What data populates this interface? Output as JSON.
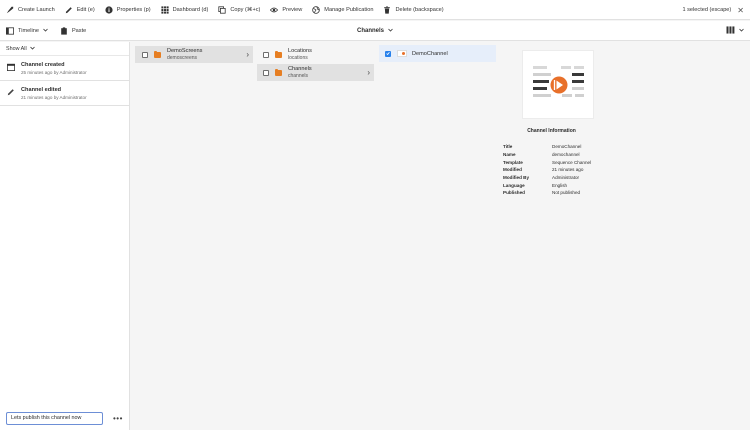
{
  "toolbar": {
    "items": [
      {
        "label": "Create Launch",
        "icon": "rocket-icon"
      },
      {
        "label": "Edit (e)",
        "icon": "pencil-icon"
      },
      {
        "label": "Properties (p)",
        "icon": "info-icon"
      },
      {
        "label": "Dashboard (d)",
        "icon": "grid-icon"
      },
      {
        "label": "Copy (⌘+c)",
        "icon": "copy-icon"
      },
      {
        "label": "Preview",
        "icon": "eye-icon"
      },
      {
        "label": "Manage Publication",
        "icon": "globe-icon"
      },
      {
        "label": "Delete (backspace)",
        "icon": "trash-icon"
      }
    ],
    "selection_label": "1 selected (escape)"
  },
  "subbar": {
    "timeline_label": "Timeline",
    "paste_label": "Paste",
    "title": "Channels"
  },
  "rail": {
    "filter_label": "Show All",
    "events": [
      {
        "title": "Channel created",
        "subtitle": "25 minutes ago by Administrator",
        "icon": "calendar-icon"
      },
      {
        "title": "Channel edited",
        "subtitle": "21 minutes ago by Administrator",
        "icon": "pencil-icon"
      }
    ],
    "comment_value": "Lets publish this channel now",
    "more_label": "•••"
  },
  "columns": {
    "col1": [
      {
        "title": "DemoScreens",
        "subtitle": "demoscreens"
      }
    ],
    "col2": [
      {
        "title": "Locations",
        "subtitle": "locations"
      },
      {
        "title": "Channels",
        "subtitle": "channels"
      }
    ],
    "col3": [
      {
        "title": "DemoChannel"
      }
    ]
  },
  "info": {
    "heading": "Channel Information",
    "rows": [
      {
        "key": "Title",
        "value": "DemoChannel"
      },
      {
        "key": "Name",
        "value": "demochannel"
      },
      {
        "key": "Template",
        "value": "Sequence Channel"
      },
      {
        "key": "Modified",
        "value": "21 minutes ago"
      },
      {
        "key": "Modified By",
        "value": "Administrator"
      },
      {
        "key": "Language",
        "value": "English"
      },
      {
        "key": "Published",
        "value": "Not published"
      }
    ]
  },
  "colors": {
    "accent": "#2680eb",
    "folder": "#e67e22",
    "play": "#e8702a"
  }
}
